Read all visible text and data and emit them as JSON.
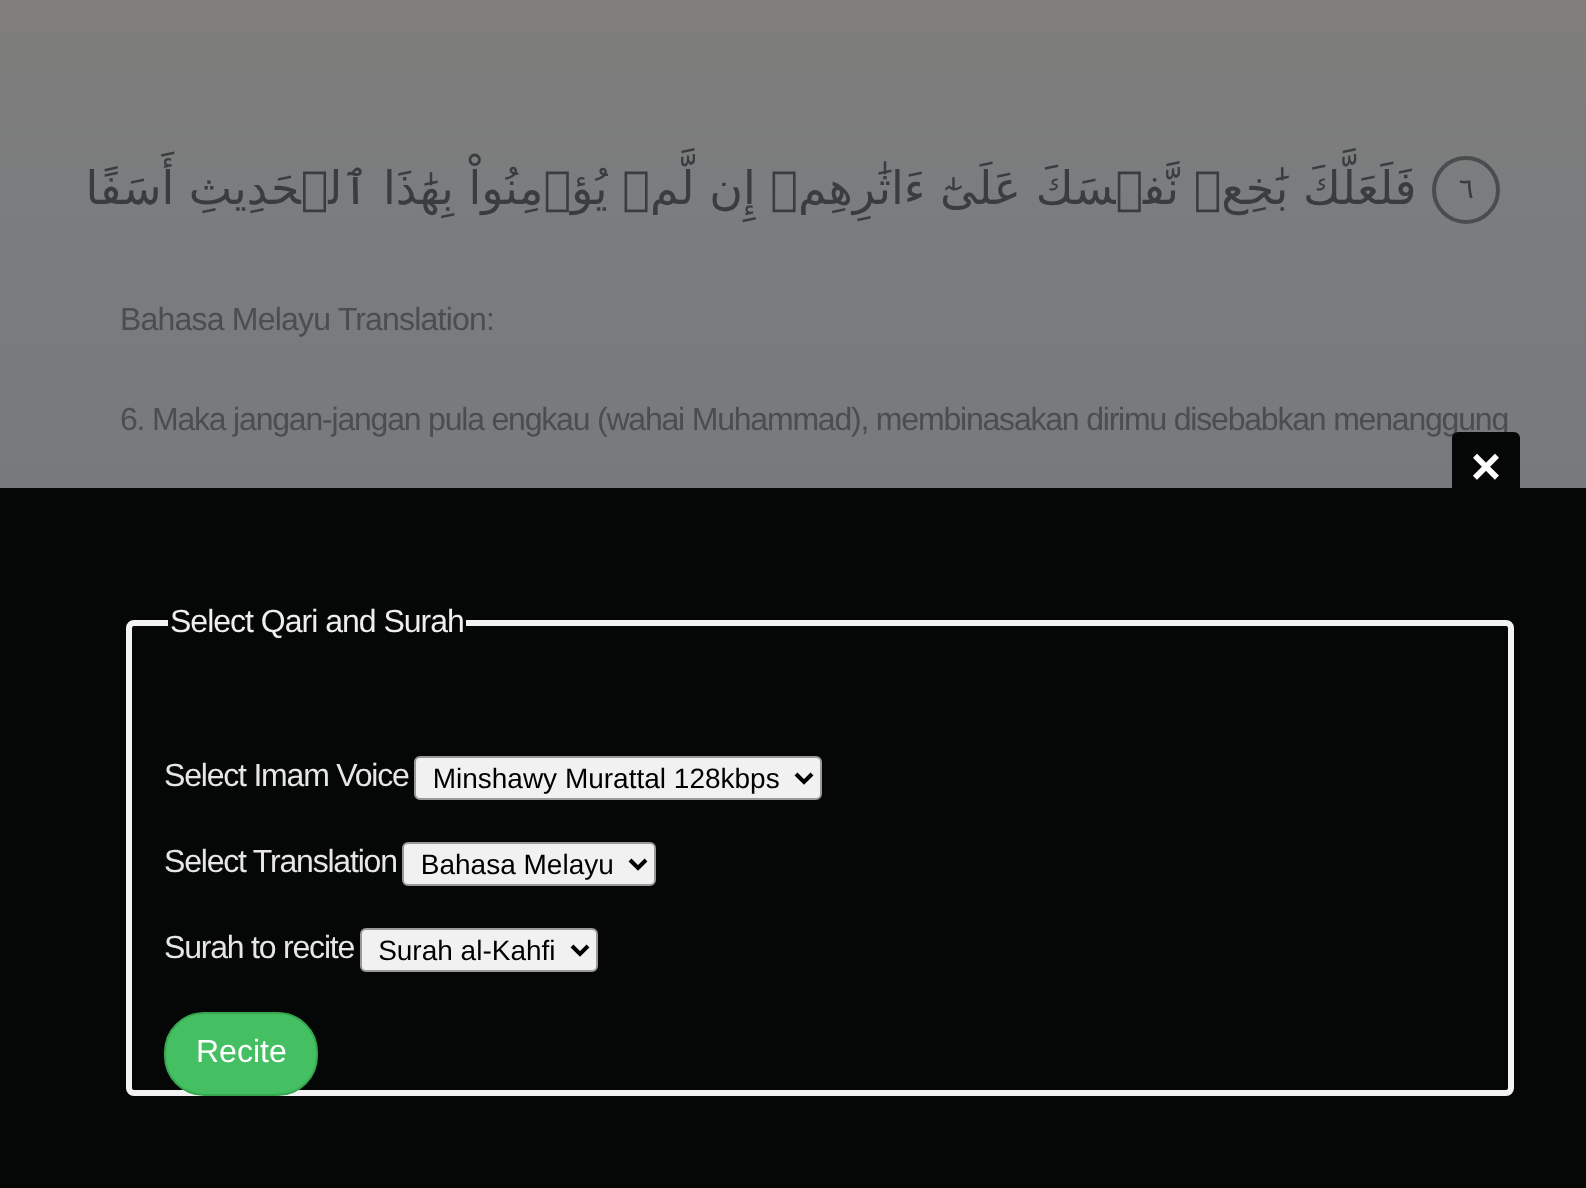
{
  "verse": {
    "arabic": "فَلَعَلَّكَ بَٰخِعٞ نَّفۡسَكَ عَلَىٰٓ ءَاثَٰرِهِمۡ إِن لَّمۡ يُؤۡمِنُواْ بِهَٰذَا ٱلۡحَدِيثِ أَسَفًا",
    "number": "٦"
  },
  "translation_heading": "Bahasa Melayu Translation:",
  "translation_text": "6. Maka jangan-jangan pula engkau (wahai Muhammad), membinasakan dirimu disebabkan menanggung",
  "close_button": "×",
  "form": {
    "legend": "Select Qari and Surah",
    "fields": [
      {
        "label": "Select Imam Voice",
        "value": "Minshawy Murattal 128kbps"
      },
      {
        "label": "Select Translation",
        "value": "Bahasa Melayu"
      },
      {
        "label": "Surah to recite",
        "value": "Surah al-Kahfi"
      }
    ],
    "submit": "Recite"
  }
}
